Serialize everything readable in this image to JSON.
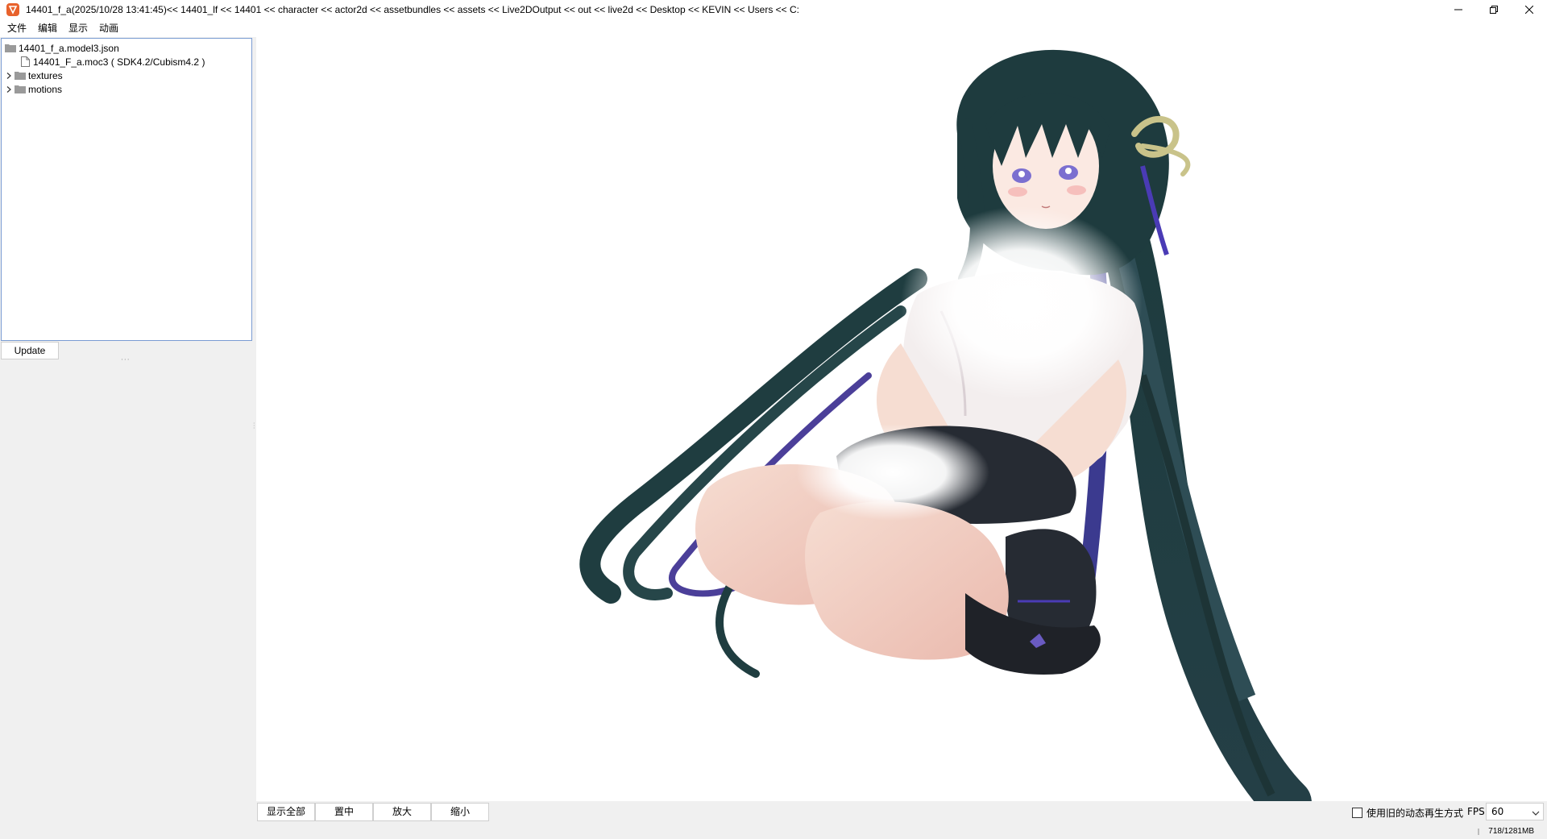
{
  "window": {
    "title": "14401_f_a(2025/10/28 13:41:45)<< 14401_lf << 14401 << character << actor2d << assetbundles << assets << Live2DOutput << out << live2d << Desktop << KEVIN << Users << C:",
    "controls": [
      "minimize-icon",
      "restore-icon",
      "close-icon"
    ]
  },
  "menu": {
    "items": [
      "文件",
      "编辑",
      "显示",
      "动画"
    ]
  },
  "tree": {
    "root": "14401_f_a.model3.json",
    "children": [
      {
        "label": "14401_F_a.moc3 ( SDK4.2/Cubism4.2 )",
        "type": "file"
      },
      {
        "label": "textures",
        "type": "folder"
      },
      {
        "label": "motions",
        "type": "folder"
      }
    ]
  },
  "left": {
    "update_label": "Update"
  },
  "toolbar": {
    "show_all": "显示全部",
    "center": "置中",
    "zoom_in": "放大",
    "zoom_out": "缩小",
    "old_mode_label": "使用旧的动态再生方式",
    "fps_label": "FPS",
    "fps_value": "60"
  },
  "status": {
    "memory": "718/1281MB"
  },
  "colors": {
    "accent": "#7a9cd3",
    "app_icon": "#e8622c",
    "hair": "#1c3a3c",
    "hair_highlight": "#5a48a8"
  }
}
